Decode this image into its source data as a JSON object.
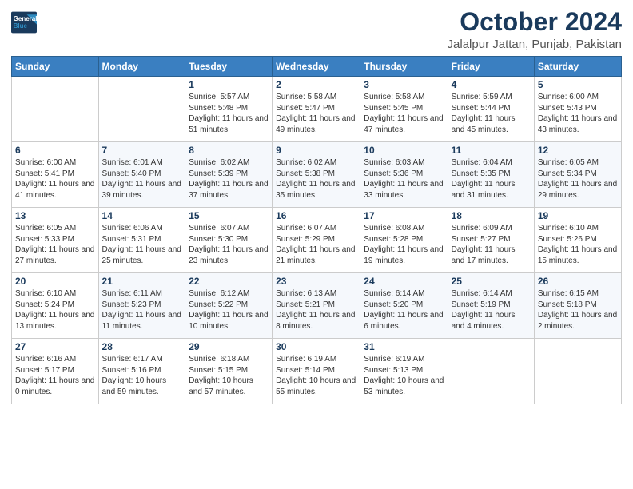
{
  "header": {
    "logo_line1": "General",
    "logo_line2": "Blue",
    "month": "October 2024",
    "location": "Jalalpur Jattan, Punjab, Pakistan"
  },
  "weekdays": [
    "Sunday",
    "Monday",
    "Tuesday",
    "Wednesday",
    "Thursday",
    "Friday",
    "Saturday"
  ],
  "weeks": [
    [
      {
        "day": "",
        "sunrise": "",
        "sunset": "",
        "daylight": ""
      },
      {
        "day": "",
        "sunrise": "",
        "sunset": "",
        "daylight": ""
      },
      {
        "day": "1",
        "sunrise": "Sunrise: 5:57 AM",
        "sunset": "Sunset: 5:48 PM",
        "daylight": "Daylight: 11 hours and 51 minutes."
      },
      {
        "day": "2",
        "sunrise": "Sunrise: 5:58 AM",
        "sunset": "Sunset: 5:47 PM",
        "daylight": "Daylight: 11 hours and 49 minutes."
      },
      {
        "day": "3",
        "sunrise": "Sunrise: 5:58 AM",
        "sunset": "Sunset: 5:45 PM",
        "daylight": "Daylight: 11 hours and 47 minutes."
      },
      {
        "day": "4",
        "sunrise": "Sunrise: 5:59 AM",
        "sunset": "Sunset: 5:44 PM",
        "daylight": "Daylight: 11 hours and 45 minutes."
      },
      {
        "day": "5",
        "sunrise": "Sunrise: 6:00 AM",
        "sunset": "Sunset: 5:43 PM",
        "daylight": "Daylight: 11 hours and 43 minutes."
      }
    ],
    [
      {
        "day": "6",
        "sunrise": "Sunrise: 6:00 AM",
        "sunset": "Sunset: 5:41 PM",
        "daylight": "Daylight: 11 hours and 41 minutes."
      },
      {
        "day": "7",
        "sunrise": "Sunrise: 6:01 AM",
        "sunset": "Sunset: 5:40 PM",
        "daylight": "Daylight: 11 hours and 39 minutes."
      },
      {
        "day": "8",
        "sunrise": "Sunrise: 6:02 AM",
        "sunset": "Sunset: 5:39 PM",
        "daylight": "Daylight: 11 hours and 37 minutes."
      },
      {
        "day": "9",
        "sunrise": "Sunrise: 6:02 AM",
        "sunset": "Sunset: 5:38 PM",
        "daylight": "Daylight: 11 hours and 35 minutes."
      },
      {
        "day": "10",
        "sunrise": "Sunrise: 6:03 AM",
        "sunset": "Sunset: 5:36 PM",
        "daylight": "Daylight: 11 hours and 33 minutes."
      },
      {
        "day": "11",
        "sunrise": "Sunrise: 6:04 AM",
        "sunset": "Sunset: 5:35 PM",
        "daylight": "Daylight: 11 hours and 31 minutes."
      },
      {
        "day": "12",
        "sunrise": "Sunrise: 6:05 AM",
        "sunset": "Sunset: 5:34 PM",
        "daylight": "Daylight: 11 hours and 29 minutes."
      }
    ],
    [
      {
        "day": "13",
        "sunrise": "Sunrise: 6:05 AM",
        "sunset": "Sunset: 5:33 PM",
        "daylight": "Daylight: 11 hours and 27 minutes."
      },
      {
        "day": "14",
        "sunrise": "Sunrise: 6:06 AM",
        "sunset": "Sunset: 5:31 PM",
        "daylight": "Daylight: 11 hours and 25 minutes."
      },
      {
        "day": "15",
        "sunrise": "Sunrise: 6:07 AM",
        "sunset": "Sunset: 5:30 PM",
        "daylight": "Daylight: 11 hours and 23 minutes."
      },
      {
        "day": "16",
        "sunrise": "Sunrise: 6:07 AM",
        "sunset": "Sunset: 5:29 PM",
        "daylight": "Daylight: 11 hours and 21 minutes."
      },
      {
        "day": "17",
        "sunrise": "Sunrise: 6:08 AM",
        "sunset": "Sunset: 5:28 PM",
        "daylight": "Daylight: 11 hours and 19 minutes."
      },
      {
        "day": "18",
        "sunrise": "Sunrise: 6:09 AM",
        "sunset": "Sunset: 5:27 PM",
        "daylight": "Daylight: 11 hours and 17 minutes."
      },
      {
        "day": "19",
        "sunrise": "Sunrise: 6:10 AM",
        "sunset": "Sunset: 5:26 PM",
        "daylight": "Daylight: 11 hours and 15 minutes."
      }
    ],
    [
      {
        "day": "20",
        "sunrise": "Sunrise: 6:10 AM",
        "sunset": "Sunset: 5:24 PM",
        "daylight": "Daylight: 11 hours and 13 minutes."
      },
      {
        "day": "21",
        "sunrise": "Sunrise: 6:11 AM",
        "sunset": "Sunset: 5:23 PM",
        "daylight": "Daylight: 11 hours and 11 minutes."
      },
      {
        "day": "22",
        "sunrise": "Sunrise: 6:12 AM",
        "sunset": "Sunset: 5:22 PM",
        "daylight": "Daylight: 11 hours and 10 minutes."
      },
      {
        "day": "23",
        "sunrise": "Sunrise: 6:13 AM",
        "sunset": "Sunset: 5:21 PM",
        "daylight": "Daylight: 11 hours and 8 minutes."
      },
      {
        "day": "24",
        "sunrise": "Sunrise: 6:14 AM",
        "sunset": "Sunset: 5:20 PM",
        "daylight": "Daylight: 11 hours and 6 minutes."
      },
      {
        "day": "25",
        "sunrise": "Sunrise: 6:14 AM",
        "sunset": "Sunset: 5:19 PM",
        "daylight": "Daylight: 11 hours and 4 minutes."
      },
      {
        "day": "26",
        "sunrise": "Sunrise: 6:15 AM",
        "sunset": "Sunset: 5:18 PM",
        "daylight": "Daylight: 11 hours and 2 minutes."
      }
    ],
    [
      {
        "day": "27",
        "sunrise": "Sunrise: 6:16 AM",
        "sunset": "Sunset: 5:17 PM",
        "daylight": "Daylight: 11 hours and 0 minutes."
      },
      {
        "day": "28",
        "sunrise": "Sunrise: 6:17 AM",
        "sunset": "Sunset: 5:16 PM",
        "daylight": "Daylight: 10 hours and 59 minutes."
      },
      {
        "day": "29",
        "sunrise": "Sunrise: 6:18 AM",
        "sunset": "Sunset: 5:15 PM",
        "daylight": "Daylight: 10 hours and 57 minutes."
      },
      {
        "day": "30",
        "sunrise": "Sunrise: 6:19 AM",
        "sunset": "Sunset: 5:14 PM",
        "daylight": "Daylight: 10 hours and 55 minutes."
      },
      {
        "day": "31",
        "sunrise": "Sunrise: 6:19 AM",
        "sunset": "Sunset: 5:13 PM",
        "daylight": "Daylight: 10 hours and 53 minutes."
      },
      {
        "day": "",
        "sunrise": "",
        "sunset": "",
        "daylight": ""
      },
      {
        "day": "",
        "sunrise": "",
        "sunset": "",
        "daylight": ""
      }
    ]
  ]
}
